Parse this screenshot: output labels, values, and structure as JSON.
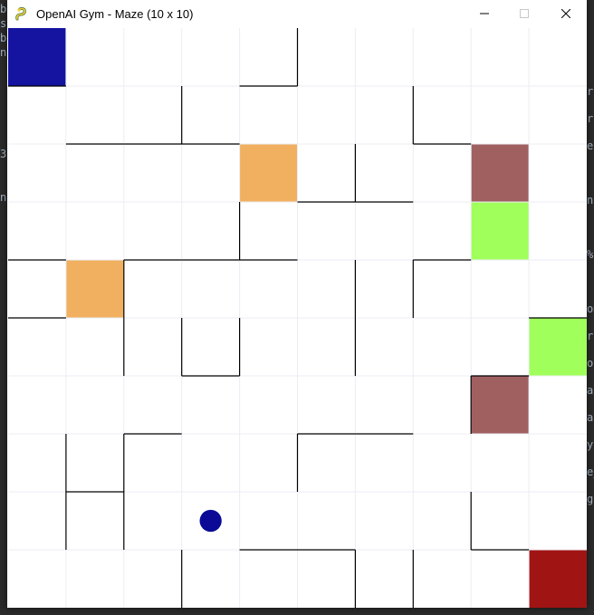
{
  "window": {
    "title": "OpenAI Gym - Maze (10 x 10)",
    "icons": {
      "app": "pygame-snake-icon",
      "minimize": "minimize-icon",
      "maximize": "maximize-icon",
      "close": "close-icon"
    }
  },
  "background_code": {
    "left_column": [
      "b",
      "sp",
      "b",
      "n",
      "",
      "",
      "",
      "",
      "",
      "",
      "3",
      "",
      "",
      "n"
    ],
    "right_column": [
      "re",
      "re",
      "er",
      "",
      "ng",
      "",
      "%",
      "",
      "om",
      "re",
      "ou",
      "ap",
      "a.",
      "y(",
      "e_",
      "ge"
    ]
  },
  "maze": {
    "rows": 10,
    "cols": 10,
    "colors": {
      "start": "#1414a0",
      "goal": "#a01414",
      "portal_orange": "#f0b060",
      "portal_brown": "#a06060",
      "portal_green": "#a0ff5a",
      "robot": "#0a0a96",
      "grid_line": "#ececf4",
      "wall": "#000000",
      "floor": "#ffffff"
    },
    "colored_cells": [
      {
        "r": 0,
        "c": 0,
        "kind": "start"
      },
      {
        "r": 9,
        "c": 9,
        "kind": "goal"
      },
      {
        "r": 2,
        "c": 4,
        "kind": "portal_orange"
      },
      {
        "r": 4,
        "c": 1,
        "kind": "portal_orange"
      },
      {
        "r": 2,
        "c": 8,
        "kind": "portal_brown"
      },
      {
        "r": 6,
        "c": 8,
        "kind": "portal_brown"
      },
      {
        "r": 3,
        "c": 8,
        "kind": "portal_green"
      },
      {
        "r": 5,
        "c": 9,
        "kind": "portal_green"
      }
    ],
    "robot": {
      "r": 8,
      "c": 3
    },
    "h_walls": [
      [
        1,
        0,
        0,
        0,
        1,
        0,
        0,
        0,
        0,
        0
      ],
      [
        0,
        1,
        1,
        1,
        0,
        0,
        0,
        1,
        0,
        0
      ],
      [
        0,
        0,
        0,
        0,
        0,
        1,
        1,
        0,
        0,
        0
      ],
      [
        1,
        0,
        1,
        1,
        1,
        0,
        0,
        1,
        0,
        0
      ],
      [
        1,
        0,
        0,
        0,
        0,
        0,
        0,
        0,
        0,
        1
      ],
      [
        0,
        0,
        0,
        1,
        0,
        0,
        0,
        0,
        1,
        0
      ],
      [
        0,
        0,
        1,
        0,
        0,
        1,
        1,
        0,
        0,
        0
      ],
      [
        0,
        1,
        0,
        0,
        0,
        0,
        0,
        0,
        0,
        0
      ],
      [
        0,
        0,
        0,
        0,
        1,
        1,
        0,
        0,
        1,
        0
      ]
    ],
    "v_walls": [
      [
        0,
        0,
        0,
        0,
        1,
        0,
        0,
        0,
        0
      ],
      [
        0,
        0,
        1,
        0,
        0,
        0,
        1,
        0,
        0
      ],
      [
        0,
        0,
        0,
        0,
        0,
        1,
        0,
        0,
        0
      ],
      [
        0,
        0,
        0,
        1,
        0,
        0,
        0,
        0,
        0
      ],
      [
        0,
        1,
        0,
        0,
        0,
        1,
        1,
        0,
        0
      ],
      [
        0,
        1,
        1,
        1,
        0,
        1,
        0,
        0,
        0
      ],
      [
        0,
        0,
        0,
        0,
        0,
        0,
        0,
        1,
        0
      ],
      [
        1,
        1,
        0,
        0,
        1,
        0,
        0,
        0,
        0
      ],
      [
        1,
        1,
        0,
        0,
        0,
        0,
        0,
        1,
        0
      ],
      [
        0,
        0,
        1,
        0,
        0,
        1,
        1,
        0,
        0
      ]
    ]
  }
}
